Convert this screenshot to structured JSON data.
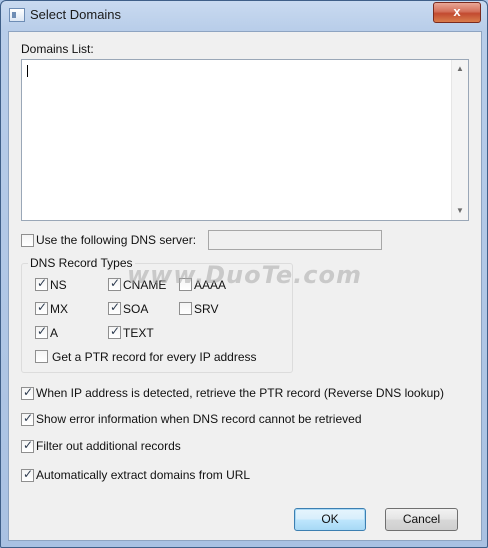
{
  "window": {
    "title": "Select Domains",
    "close_glyph": "x"
  },
  "domains_list": {
    "label": "Domains List:",
    "value": ""
  },
  "dns_server": {
    "label": "Use the following DNS server:",
    "checked": false,
    "value": ""
  },
  "record_types": {
    "title": "DNS Record Types",
    "items": [
      {
        "label": "NS",
        "checked": true
      },
      {
        "label": "CNAME",
        "checked": true
      },
      {
        "label": "AAAA",
        "checked": false
      },
      {
        "label": "MX",
        "checked": true
      },
      {
        "label": "SOA",
        "checked": true
      },
      {
        "label": "SRV",
        "checked": false
      },
      {
        "label": "A",
        "checked": true
      },
      {
        "label": "TEXT",
        "checked": true
      }
    ],
    "ptr_option": {
      "label": "Get a  PTR record for every IP address",
      "checked": false
    }
  },
  "options": [
    {
      "label": "When IP address is detected, retrieve the PTR record (Reverse DNS lookup)",
      "checked": true
    },
    {
      "label": "Show error information when DNS record cannot be retrieved",
      "checked": true
    },
    {
      "label": "Filter out additional records",
      "checked": true
    },
    {
      "label": "Automatically extract domains from URL",
      "checked": true
    }
  ],
  "buttons": {
    "ok": "OK",
    "cancel": "Cancel"
  },
  "watermark": {
    "text": "www.DuoTe.com"
  }
}
